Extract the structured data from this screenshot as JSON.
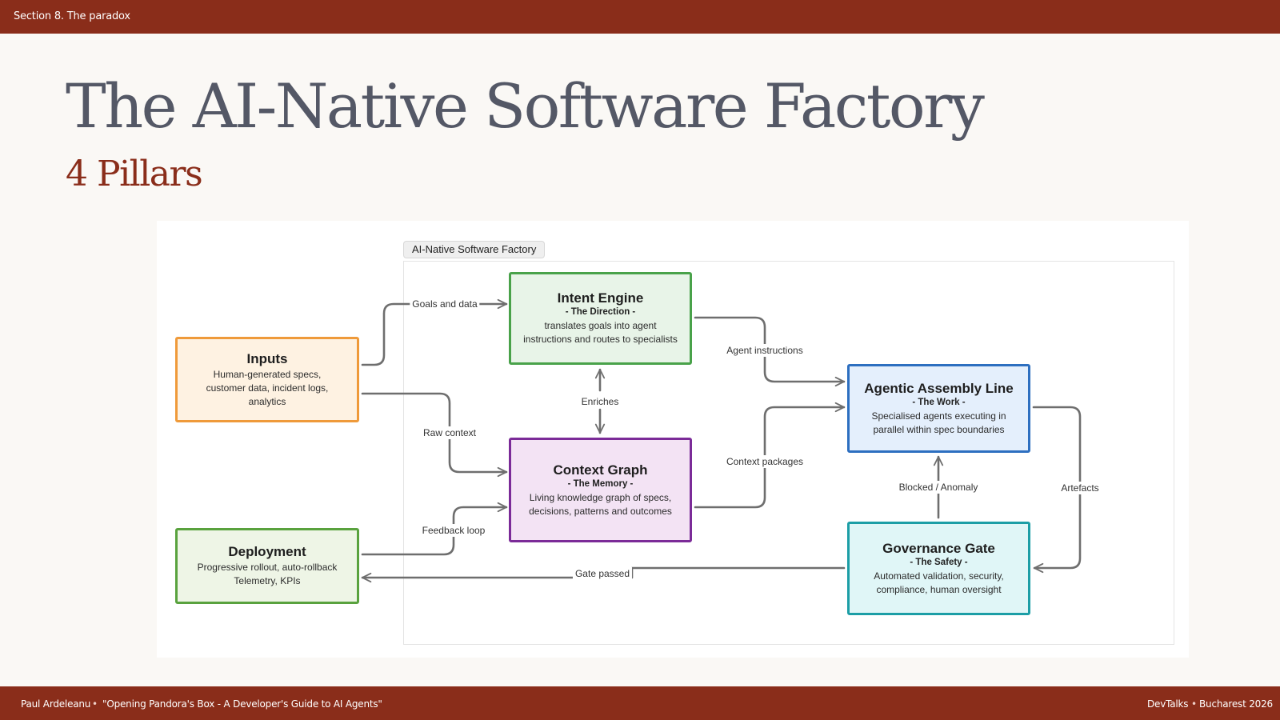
{
  "header": {
    "section": "Section 8. The paradox"
  },
  "slide": {
    "title": "The AI-Native Software Factory",
    "subtitle": "4 Pillars"
  },
  "diagram": {
    "frame_label": "AI-Native Software Factory",
    "nodes": {
      "inputs": {
        "title": "Inputs",
        "desc": "Human-generated specs,\ncustomer data, incident logs,\nanalytics",
        "border": "#ef9a3a",
        "fill": "#fef2e2"
      },
      "intent": {
        "title": "Intent Engine",
        "role": "- The Direction -",
        "desc": "translates goals into agent\ninstructions and routes to specialists",
        "border": "#49a24a",
        "fill": "#e8f4e8"
      },
      "context": {
        "title": "Context Graph",
        "role": "- The Memory -",
        "desc": "Living knowledge graph of specs,\ndecisions, patterns and outcomes",
        "border": "#7b2b98",
        "fill": "#f3e3f4"
      },
      "deployment": {
        "title": "Deployment",
        "desc": "Progressive rollout, auto-rollback\nTelemetry, KPIs",
        "border": "#59a23e",
        "fill": "#eef5e6"
      },
      "assembly": {
        "title": "Agentic Assembly Line",
        "role": "- The Work -",
        "desc": "Specialised agents executing in\nparallel within spec boundaries",
        "border": "#2d6fc0",
        "fill": "#e4effc"
      },
      "governance": {
        "title": "Governance Gate",
        "role": "- The Safety -",
        "desc": "Automated validation, security,\ncompliance, human oversight",
        "border": "#1c9ea6",
        "fill": "#e0f6f7"
      }
    },
    "edges": {
      "goals": "Goals and data",
      "raw_context": "Raw context",
      "enriches": "Enriches",
      "agent_instructions": "Agent instructions",
      "context_packages": "Context packages",
      "blocked": "Blocked / Anomaly",
      "artefacts": "Artefacts",
      "feedback": "Feedback loop",
      "gate_passed": "Gate passed"
    }
  },
  "footer": {
    "author": "Paul Ardeleanu",
    "separator": "•",
    "talk": "\"Opening Pandora's Box - A Developer's Guide to AI Agents\"",
    "event": "DevTalks",
    "location": "Bucharest 2026"
  },
  "colors": {
    "brand": "#8a2d1a",
    "title": "#545866",
    "edge": "#6e6e6e"
  }
}
